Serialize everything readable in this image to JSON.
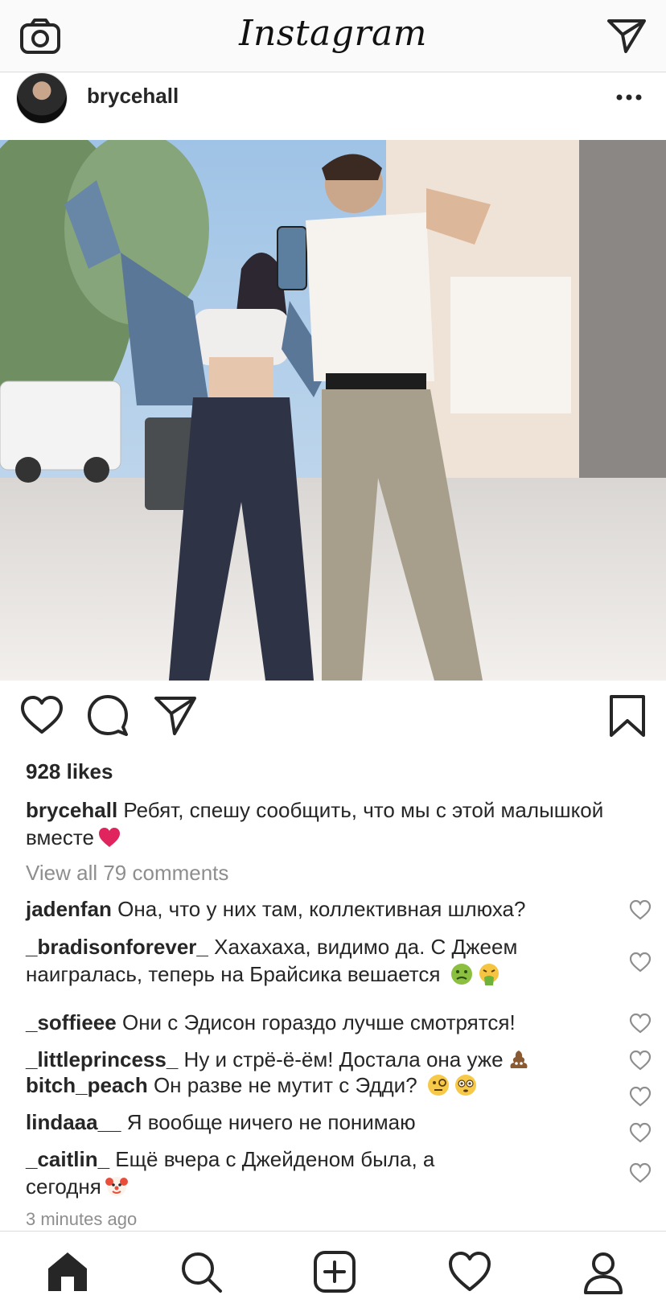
{
  "app": {
    "title": "Instagram"
  },
  "post": {
    "username": "brycehall",
    "likes": "928 likes",
    "caption_user": "brycehall",
    "caption_text": "Ребят, спешу сообщить, что мы с этой малышкой вместе",
    "view_all": "View all 79 comments",
    "timestamp": "3 minutes ago"
  },
  "comments": [
    {
      "user": "jadenfan",
      "text": "Она, что у них там, коллективная шлюха?",
      "emoji": []
    },
    {
      "user": "_bradisonforever_",
      "text": "Хахахаха, видимо да. С Джеем наигралась, теперь на Брайсика вешается",
      "emoji": [
        "nauseated-face",
        "vomiting-face"
      ]
    },
    {
      "user": "_soffieee",
      "text": "Они с Эдисон гораздо лучше смотрятся!",
      "emoji": []
    },
    {
      "user": "_littleprincess_",
      "text": "Ну и стрё-ё-ём! Достала она уже",
      "emoji": [
        "poo"
      ]
    },
    {
      "user": "bitch_peach",
      "text": "Он разве не мутит с Эдди?",
      "emoji": [
        "face-with-monocle",
        "flushed-face"
      ]
    },
    {
      "user": "lindaaa__",
      "text": "Я вообще ничего не понимаю",
      "emoji": []
    },
    {
      "user": "_caitlin_",
      "text": "Ещё вчера с Джейденом была, а сегодня",
      "emoji": [
        "clown-face"
      ]
    }
  ],
  "icons": {
    "top_left": "camera-icon",
    "top_right": "direct-message-icon",
    "post_more": "more-options-icon",
    "like": "heart-icon",
    "comment": "comment-icon",
    "share": "share-icon",
    "save": "bookmark-icon",
    "tabs": [
      "home-icon",
      "search-icon",
      "add-post-icon",
      "activity-heart-icon",
      "profile-icon"
    ]
  },
  "colors": {
    "text": "#262626",
    "muted": "#8e8e8e",
    "border": "#dbdbdb",
    "heart_emoji": "#e0245e"
  }
}
